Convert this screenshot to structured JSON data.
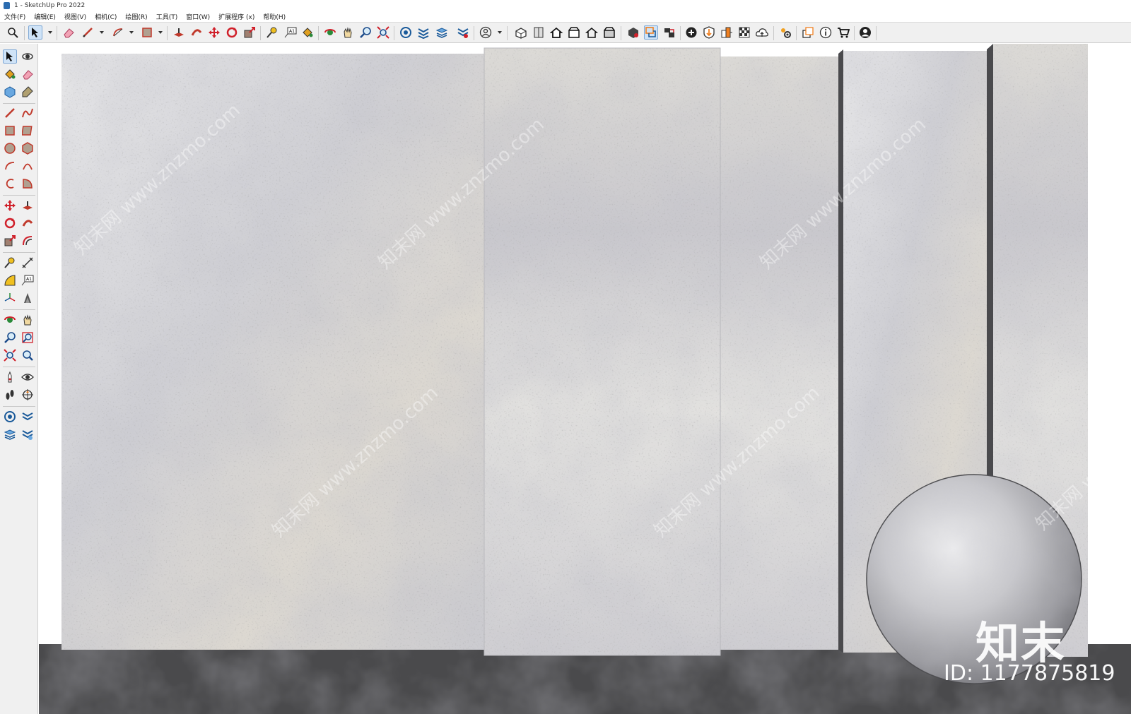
{
  "window": {
    "title": "1 - SketchUp Pro 2022"
  },
  "menu": {
    "items": [
      "文件(F)",
      "编辑(E)",
      "视图(V)",
      "相机(C)",
      "绘图(R)",
      "工具(T)",
      "窗口(W)",
      "扩展程序 (x)",
      "帮助(H)"
    ]
  },
  "toolbar": {
    "icons": [
      "zoom-icon",
      "select-icon",
      "eraser-icon",
      "pencil-icon",
      "arc-icon",
      "rectangle-icon",
      "push-pull-icon",
      "follow-me-icon",
      "move-icon",
      "rotate-icon",
      "scale-icon",
      "tape-measure-icon",
      "text-icon",
      "paint-bucket-icon",
      "orbit-icon",
      "pan-icon",
      "zoom-tool-icon",
      "zoom-extents-icon",
      "sandbox-icon",
      "section-plane-icon",
      "layers-icon",
      "styles-icon",
      "user-icon",
      "iso-view-icon",
      "top-view-icon",
      "front-view-icon",
      "right-view-icon",
      "back-view-icon",
      "left-view-icon",
      "component-icon",
      "group-icon",
      "scene-icon",
      "add-location-icon",
      "solid-tools-icon",
      "geo-icon",
      "warehouse-icon",
      "cloud-upload-icon",
      "extension-manager-icon",
      "dynamic-component-icon",
      "info-icon",
      "cart-icon",
      "account-icon"
    ]
  },
  "watermark": {
    "logo": "知末",
    "id_text": "ID: 1177875819",
    "diagonal": "知末网 www.znzmo.com"
  },
  "colors": {
    "toolbar_bg": "#f0f0f0",
    "ground": "#4a4a4a",
    "concrete_light": "#e3e3e5",
    "concrete_mid": "#c8c8cc",
    "concrete_warm": "#d8d3cc",
    "active_tool": "#cfe3f7"
  }
}
